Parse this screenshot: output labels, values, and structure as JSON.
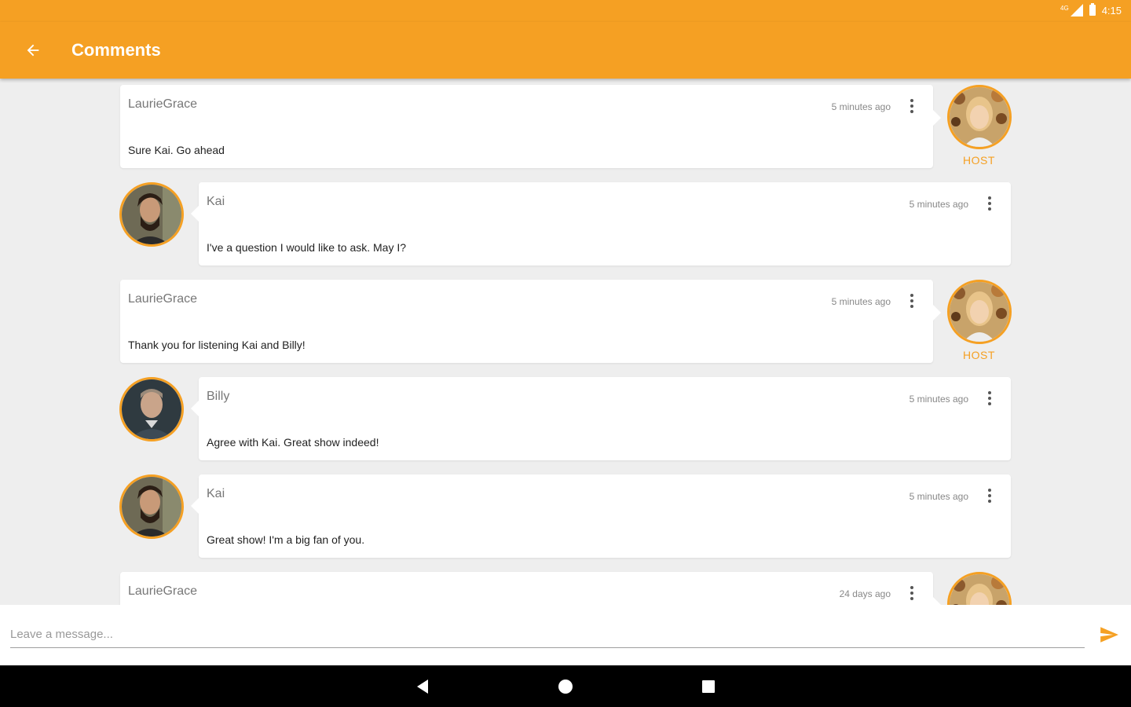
{
  "status_bar": {
    "time": "4:15",
    "signal_label": "4G"
  },
  "app_bar": {
    "title": "Comments",
    "back_icon": "arrow-back-icon"
  },
  "comments": [
    {
      "author": "LaurieGrace",
      "time": "5 minutes ago",
      "message": "Sure Kai. Go ahead",
      "role": "host",
      "badge": "HOST"
    },
    {
      "author": "Kai",
      "time": "5 minutes ago",
      "message": "I've a question I would like to ask. May I?",
      "role": "guest"
    },
    {
      "author": "LaurieGrace",
      "time": "5 minutes ago",
      "message": "Thank you for listening Kai and Billy!",
      "role": "host",
      "badge": "HOST"
    },
    {
      "author": "Billy",
      "time": "5 minutes ago",
      "message": "Agree with Kai. Great show indeed!",
      "role": "guest"
    },
    {
      "author": "Kai",
      "time": "5 minutes ago",
      "message": "Great show! I'm a big fan of you.",
      "role": "guest"
    },
    {
      "author": "LaurieGrace",
      "time": "24 days ago",
      "message": "",
      "role": "host",
      "badge": ""
    }
  ],
  "composer": {
    "placeholder": "Leave a message...",
    "value": "",
    "send_icon": "send-icon"
  },
  "nav": {
    "back_icon": "nav-back-icon",
    "home_icon": "nav-home-icon",
    "recents_icon": "nav-recents-icon"
  },
  "colors": {
    "accent": "#F5A023",
    "background": "#EEEEEE",
    "card": "#FFFFFF"
  }
}
